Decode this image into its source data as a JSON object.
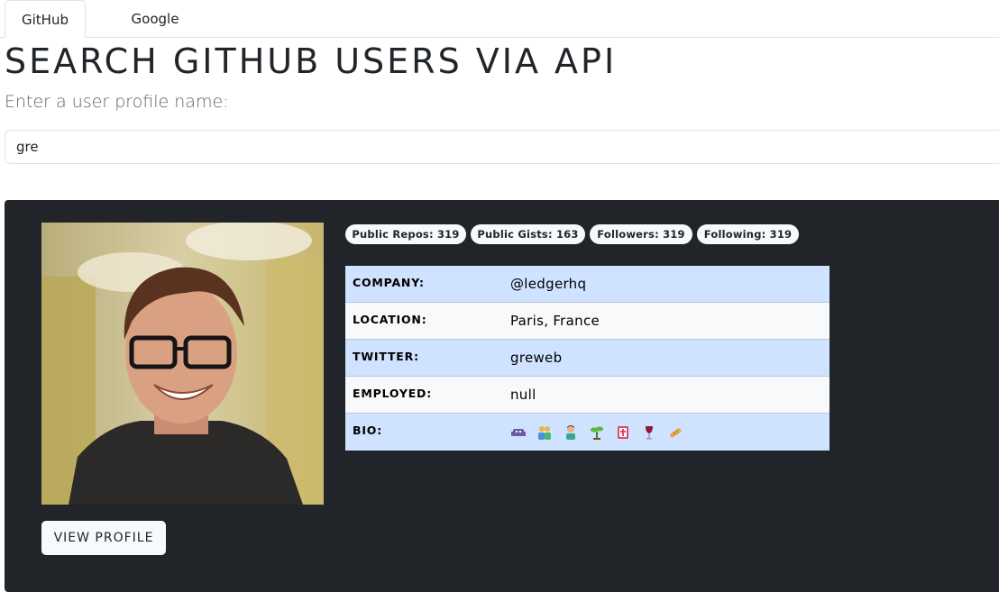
{
  "tabs": [
    {
      "label": "GitHub",
      "active": true
    },
    {
      "label": "Google",
      "active": false
    }
  ],
  "header": {
    "title": "SEARCH GITHUB USERS VIA API",
    "prompt": "Enter a user profile name:"
  },
  "search": {
    "value": "gre",
    "placeholder": ""
  },
  "profile": {
    "avatar_icon": "user-avatar-photo",
    "view_profile_label": "VIEW PROFILE",
    "badges": [
      "Public Repos: 319",
      "Public Gists: 163",
      "Followers: 319",
      "Following: 319"
    ],
    "details": [
      {
        "label": "COMPANY:",
        "value": "@ledgerhq"
      },
      {
        "label": "LOCATION:",
        "value": "Paris, France"
      },
      {
        "label": "TWITTER:",
        "value": "greweb"
      },
      {
        "label": "EMPLOYED:",
        "value": "null"
      },
      {
        "label": "BIO:",
        "value": ""
      }
    ],
    "bio_icons": [
      "alien-monster-icon",
      "people-icon",
      "person-icon",
      "seedling-icon",
      "book-icon",
      "wine-glass-icon",
      "bread-icon"
    ]
  },
  "colors": {
    "card_bg": "#212529",
    "row_blue": "#cfe2ff",
    "row_gray": "#f8f9fa"
  }
}
